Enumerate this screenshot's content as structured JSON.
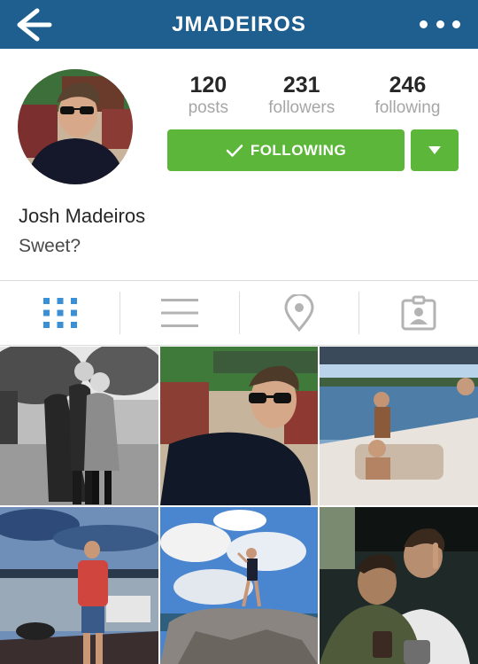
{
  "header": {
    "title": "JMADEIROS",
    "back_icon": "back-arrow-icon",
    "more_icon": "more-dots-icon"
  },
  "profile": {
    "name": "Josh Madeiros",
    "bio": "Sweet?"
  },
  "stats": [
    {
      "value": "120",
      "label": "posts"
    },
    {
      "value": "231",
      "label": "followers"
    },
    {
      "value": "246",
      "label": "following"
    }
  ],
  "actions": {
    "following_label": "FOLLOWING",
    "following_icon": "checkmark-icon",
    "dropdown_icon": "caret-down-icon"
  },
  "tabs": [
    {
      "name": "grid-view",
      "icon": "grid-icon",
      "active": true
    },
    {
      "name": "list-view",
      "icon": "list-icon",
      "active": false
    },
    {
      "name": "location-view",
      "icon": "location-pin-icon",
      "active": false
    },
    {
      "name": "tagged-view",
      "icon": "tagged-user-icon",
      "active": false
    }
  ],
  "colors": {
    "header": "#1f5f8f",
    "following_button": "#5cb63a",
    "active_tab": "#3a8fd5",
    "inactive_tab": "#b3b3b3"
  }
}
